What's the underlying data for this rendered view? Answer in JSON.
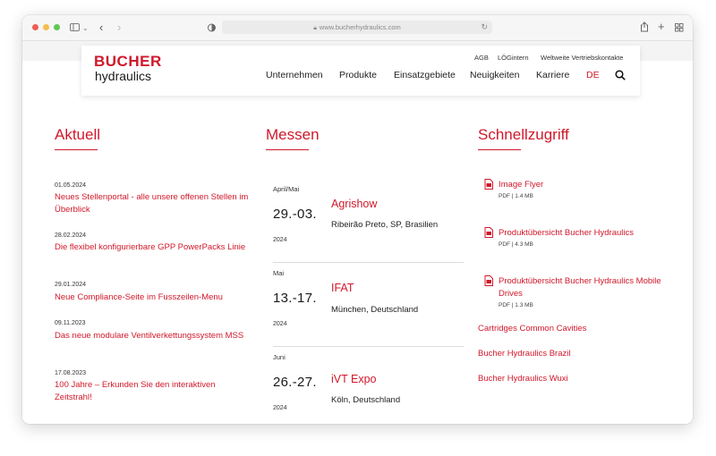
{
  "browser": {
    "url": "www.bucherhydraulics.com"
  },
  "header": {
    "logo_top": "BUCHER",
    "logo_bottom": "hydraulics",
    "utility_links": [
      "AGB",
      "LÖGintern",
      "Weltweite Vertriebskontakte"
    ],
    "nav_items": [
      "Unternehmen",
      "Produkte",
      "Einsatzgebiete",
      "Neuigkeiten",
      "Karriere"
    ],
    "language": "DE"
  },
  "aktuell": {
    "title": "Aktuell",
    "items": [
      {
        "date": "01.05.2024",
        "title": "Neues Stellenportal - alle unsere offenen Stellen im Überblick"
      },
      {
        "date": "28.02.2024",
        "title": "Die flexibel konfigurierbare GPP PowerPacks Linie"
      },
      {
        "date": "29.01.2024",
        "title": "Neue Compliance-Seite im Fusszeilen-Menu"
      },
      {
        "date": "09.11.2023",
        "title": "Das neue modulare Ventilverkettungssystem MSS"
      },
      {
        "date": "17.08.2023",
        "title": "100 Jahre – Erkunden Sie den interaktiven Zeitstrahl!"
      }
    ]
  },
  "messen": {
    "title": "Messen",
    "items": [
      {
        "month": "April/Mai",
        "range": "29.-03.",
        "year": "2024",
        "name": "Agrishow",
        "place": "Ribeirão Preto, SP, Brasilien"
      },
      {
        "month": "Mai",
        "range": "13.-17.",
        "year": "2024",
        "name": "IFAT",
        "place": "München, Deutschland"
      },
      {
        "month": "Juni",
        "range": "26.-27.",
        "year": "2024",
        "name": "iVT Expo",
        "place": "Köln, Deutschland"
      }
    ]
  },
  "schnellzugriff": {
    "title": "Schnellzugriff",
    "downloads": [
      {
        "title": "Image Flyer",
        "meta": "PDF | 1.4 MB",
        "icon": "pdf-icon"
      },
      {
        "title": "Produktübersicht Bucher Hydraulics",
        "meta": "PDF | 4.3 MB",
        "icon": "pdf-icon"
      },
      {
        "title": "Produktübersicht Bucher Hydraulics Mobile Drives",
        "meta": "PDF | 1.3 MB",
        "icon": "pdf-icon"
      }
    ],
    "links": [
      "Cartridges Common Cavities",
      "Bucher Hydraulics Brazil",
      "Bucher Hydraulics Wuxi"
    ]
  },
  "colors": {
    "accent": "#d0182a",
    "text": "#222222"
  }
}
